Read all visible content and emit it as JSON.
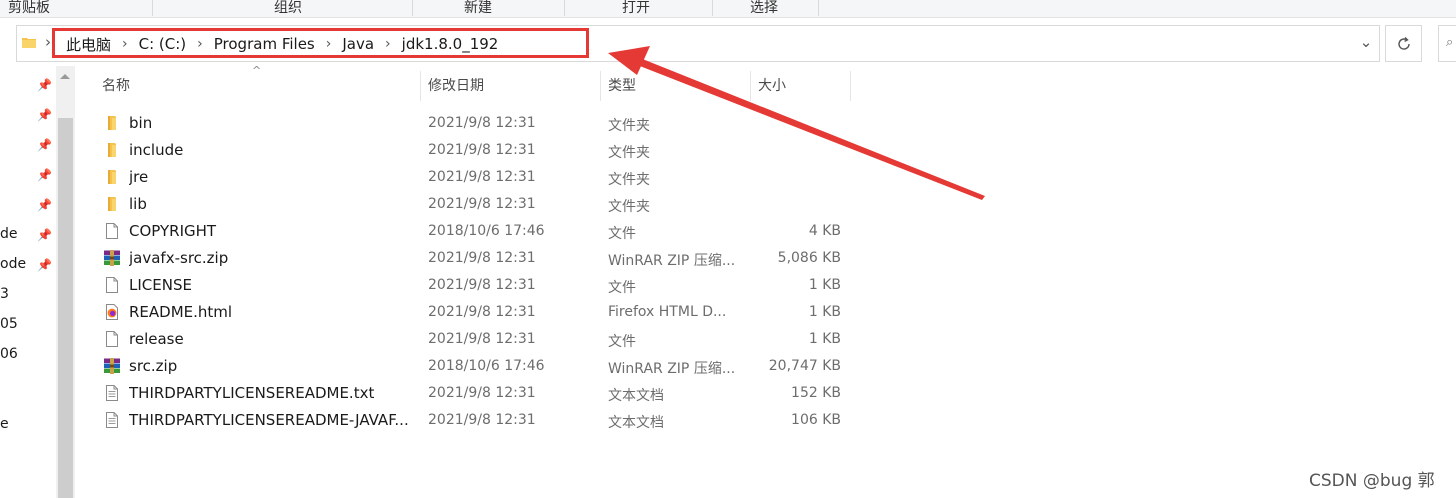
{
  "ribbon": {
    "groups": [
      "剪贴板",
      "组织",
      "新建",
      "打开",
      "选择"
    ]
  },
  "address_bar": {
    "breadcrumbs": [
      "此电脑",
      "C: (C:)",
      "Program Files",
      "Java",
      "jdk1.8.0_192"
    ],
    "folder_icon": "folder-icon",
    "separator_icon": "chevron-right-icon",
    "dropdown_icon": "chevron-down-icon",
    "refresh_icon": "refresh-icon"
  },
  "nav_pane": {
    "visible_labels": [
      "de",
      "ode",
      "3",
      "05",
      "06",
      "e"
    ],
    "pin_icon": "pin-icon"
  },
  "columns": {
    "name": "名称",
    "modified": "修改日期",
    "type": "类型",
    "size": "大小"
  },
  "files": [
    {
      "name": "bin",
      "modified": "2021/9/8 12:31",
      "type": "文件夹",
      "size": "",
      "icon": "folder-icon"
    },
    {
      "name": "include",
      "modified": "2021/9/8 12:31",
      "type": "文件夹",
      "size": "",
      "icon": "folder-icon"
    },
    {
      "name": "jre",
      "modified": "2021/9/8 12:31",
      "type": "文件夹",
      "size": "",
      "icon": "folder-icon"
    },
    {
      "name": "lib",
      "modified": "2021/9/8 12:31",
      "type": "文件夹",
      "size": "",
      "icon": "folder-icon"
    },
    {
      "name": "COPYRIGHT",
      "modified": "2018/10/6 17:46",
      "type": "文件",
      "size": "4 KB",
      "icon": "file-icon"
    },
    {
      "name": "javafx-src.zip",
      "modified": "2021/9/8 12:31",
      "type": "WinRAR ZIP 压缩...",
      "size": "5,086 KB",
      "icon": "winrar-archive-icon"
    },
    {
      "name": "LICENSE",
      "modified": "2021/9/8 12:31",
      "type": "文件",
      "size": "1 KB",
      "icon": "file-icon"
    },
    {
      "name": "README.html",
      "modified": "2021/9/8 12:31",
      "type": "Firefox HTML D...",
      "size": "1 KB",
      "icon": "firefox-html-icon"
    },
    {
      "name": "release",
      "modified": "2021/9/8 12:31",
      "type": "文件",
      "size": "1 KB",
      "icon": "file-icon"
    },
    {
      "name": "src.zip",
      "modified": "2018/10/6 17:46",
      "type": "WinRAR ZIP 压缩...",
      "size": "20,747 KB",
      "icon": "winrar-archive-icon"
    },
    {
      "name": "THIRDPARTYLICENSEREADME.txt",
      "modified": "2021/9/8 12:31",
      "type": "文本文档",
      "size": "152 KB",
      "icon": "text-document-icon"
    },
    {
      "name": "THIRDPARTYLICENSEREADME-JAVAF...",
      "modified": "2021/9/8 12:31",
      "type": "文本文档",
      "size": "106 KB",
      "icon": "text-document-icon"
    }
  ],
  "annotation": {
    "color": "#e53935"
  },
  "watermark": "CSDN @bug 郭",
  "colors": {
    "accent_red": "#e53935",
    "folder_yellow": "#f4c24d"
  }
}
